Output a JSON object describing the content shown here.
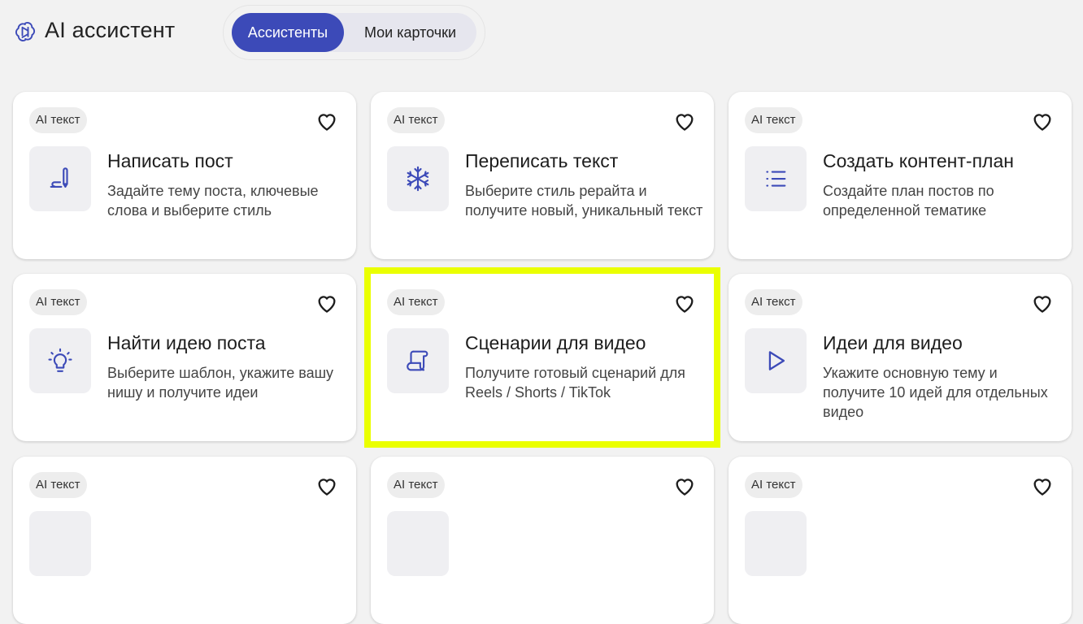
{
  "header": {
    "logo_icon": "openai-knot-icon",
    "title": "AI ассистент",
    "tabs": [
      {
        "label": "Ассистенты",
        "active": true
      },
      {
        "label": "Мои карточки",
        "active": false
      }
    ]
  },
  "colors": {
    "accent": "#3c4ab8",
    "icon_stroke": "#3c4ab8",
    "highlight": "#eaff00",
    "background": "#f2f2f2"
  },
  "cards": [
    {
      "badge": "AI текст",
      "title": "Написать пост",
      "description": "Задайте тему поста, ключевые слова и выберите стиль",
      "icon": "pen-icon"
    },
    {
      "badge": "AI текст",
      "title": "Переписать текст",
      "description": "Выберите стиль рерайта и получите новый, уникальный текст",
      "icon": "snowflake-icon"
    },
    {
      "badge": "AI текст",
      "title": "Создать контент-план",
      "description": "Создайте план постов по определенной тематике",
      "icon": "list-icon"
    },
    {
      "badge": "AI текст",
      "title": "Найти идею поста",
      "description": "Выберите шаблон, укажите вашу нишу и получите идеи",
      "icon": "lightbulb-icon"
    },
    {
      "badge": "AI текст",
      "title": "Сценарии для видео",
      "description": "Получите готовый сценарий для Reels / Shorts / TikTok",
      "icon": "scroll-icon"
    },
    {
      "badge": "AI текст",
      "title": "Идеи для видео",
      "description": "Укажите основную тему и получите 10 идей для отдельных видео",
      "icon": "play-icon"
    },
    {
      "badge": "AI текст",
      "title": "",
      "description": "",
      "icon": ""
    },
    {
      "badge": "AI текст",
      "title": "",
      "description": "",
      "icon": ""
    },
    {
      "badge": "AI текст",
      "title": "",
      "description": "",
      "icon": ""
    }
  ]
}
